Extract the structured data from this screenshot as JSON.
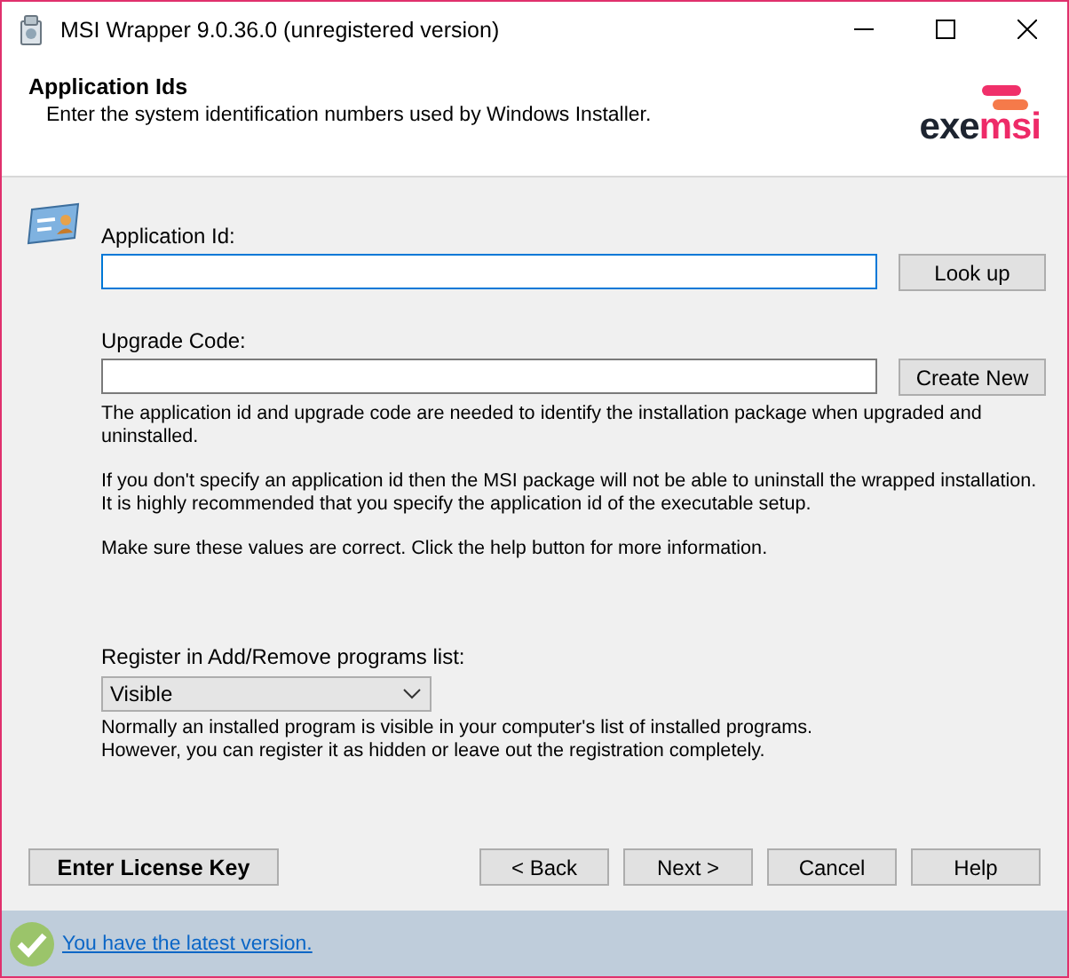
{
  "window": {
    "title": "MSI Wrapper 9.0.36.0 (unregistered version)"
  },
  "header": {
    "title": "Application Ids",
    "subtitle": "Enter the system identification numbers used by Windows Installer.",
    "logo": [
      "exe",
      "msi"
    ]
  },
  "fields": [
    {
      "label": "Application Id:",
      "focused": true,
      "button": "Look up"
    },
    {
      "label": "Upgrade Code:",
      "focused": false,
      "button": "Create New"
    }
  ],
  "notes": [
    [
      "The application id and upgrade code are needed to identify the installation package when upgraded and",
      "uninstalled."
    ],
    [
      "If you don't specify an application id then the MSI package will not be able to uninstall the wrapped installation.",
      "It is highly recommended that you specify the application id of the executable setup."
    ],
    [
      "Make sure these values are correct. Click the help button for more information."
    ]
  ],
  "register": {
    "label": "Register in Add/Remove programs list:",
    "value": "Visible",
    "note": [
      "Normally an installed program is visible in your computer's list of installed programs.",
      "However, you can register it as hidden or leave out the registration completely."
    ]
  },
  "license_button": "Enter License Key",
  "buttons": [
    "< Back",
    "Next >",
    "Cancel",
    "Help"
  ],
  "status_bar": {
    "link": "You have the latest version."
  }
}
